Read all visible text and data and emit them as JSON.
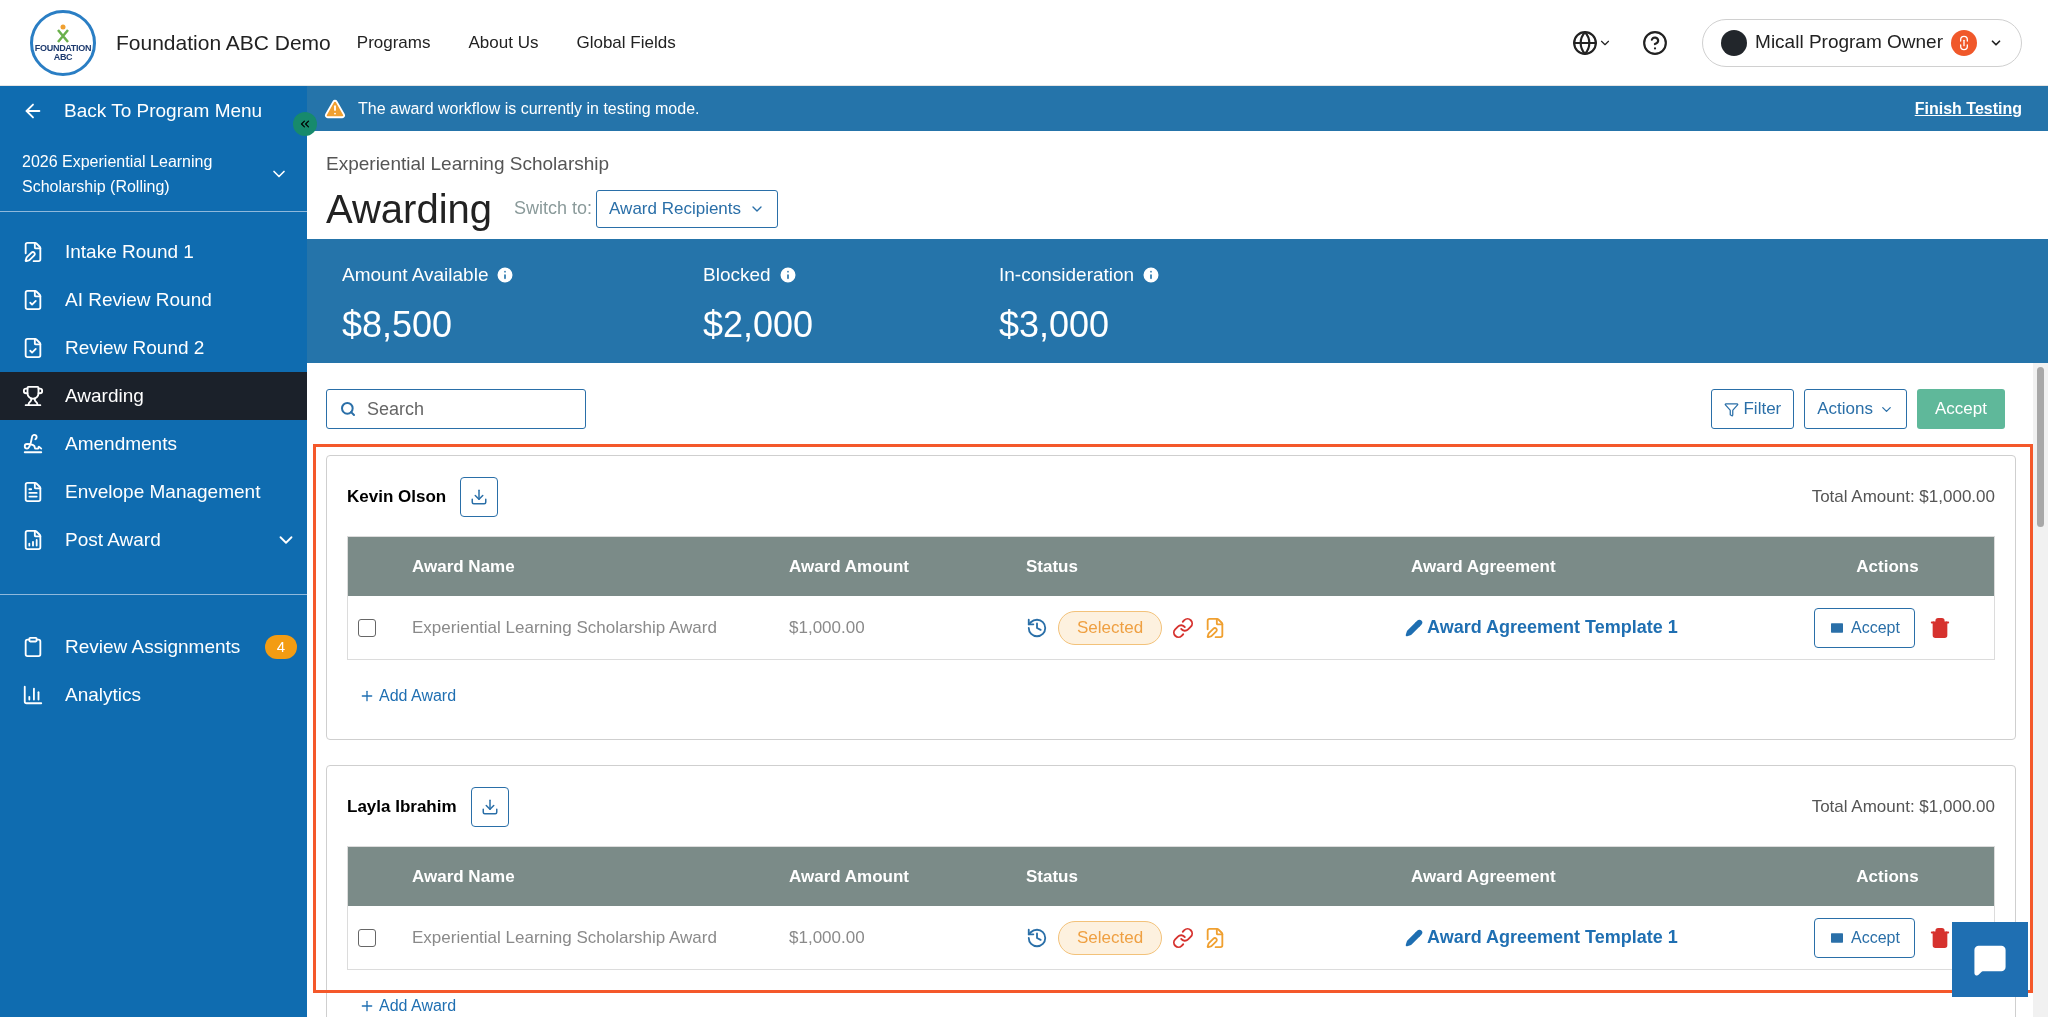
{
  "header": {
    "logo_lines": [
      "FOUNDATION",
      "ABC"
    ],
    "brand": "Foundation ABC Demo",
    "nav": [
      "Programs",
      "About Us",
      "Global Fields"
    ],
    "user": {
      "name": "Micall Program Owner"
    }
  },
  "sidebar": {
    "back": "Back To Program Menu",
    "program": "2026 Experiential Learning Scholarship (Rolling)",
    "items": [
      {
        "label": "Intake Round 1",
        "selected": false
      },
      {
        "label": "AI Review Round",
        "selected": false
      },
      {
        "label": "Review Round 2",
        "selected": false
      },
      {
        "label": "Awarding",
        "selected": true
      },
      {
        "label": "Amendments",
        "selected": false
      },
      {
        "label": "Envelope Management",
        "selected": false
      },
      {
        "label": "Post Award",
        "selected": false,
        "expanded": false
      }
    ],
    "secondary": [
      {
        "label": "Review Assignments",
        "badge": "4",
        "selected": false
      },
      {
        "label": "Analytics",
        "selected": false
      }
    ]
  },
  "banner": {
    "message": "The award workflow is currently in testing mode.",
    "link": "Finish Testing"
  },
  "page": {
    "breadcrumb": "Experiential Learning Scholarship",
    "title": "Awarding",
    "switch_label": "Switch to:",
    "switch_value": "Award Recipients"
  },
  "stats": [
    {
      "label": "Amount Available",
      "value": "$8,500"
    },
    {
      "label": "Blocked",
      "value": "$2,000"
    },
    {
      "label": "In-consideration",
      "value": "$3,000"
    }
  ],
  "toolbar": {
    "search": {
      "placeholder": "Search"
    },
    "filter": "Filter",
    "actions": "Actions",
    "accept": "Accept"
  },
  "recipients": [
    {
      "name": "Kevin Olson",
      "total": "Total Amount: $1,000.00",
      "columns": [
        "Award Name",
        "Award Amount",
        "Status",
        "Award Agreement",
        "Actions"
      ],
      "add_award": "Add Award",
      "rows": [
        {
          "checked": false,
          "award_name": "Experiential Learning Scholarship Award",
          "amount": "$1,000.00",
          "status": "Selected",
          "agreement": "Award Agreement Template 1",
          "action": "Accept"
        }
      ]
    },
    {
      "name": "Layla Ibrahim",
      "total": "Total Amount: $1,000.00",
      "columns": [
        "Award Name",
        "Award Amount",
        "Status",
        "Award Agreement",
        "Actions"
      ],
      "add_award": "Add Award",
      "rows": [
        {
          "checked": false,
          "award_name": "Experiential Learning Scholarship Award",
          "amount": "$1,000.00",
          "status": "Selected",
          "agreement": "Award Agreement Template 1",
          "action": "Accept"
        }
      ]
    }
  ]
}
